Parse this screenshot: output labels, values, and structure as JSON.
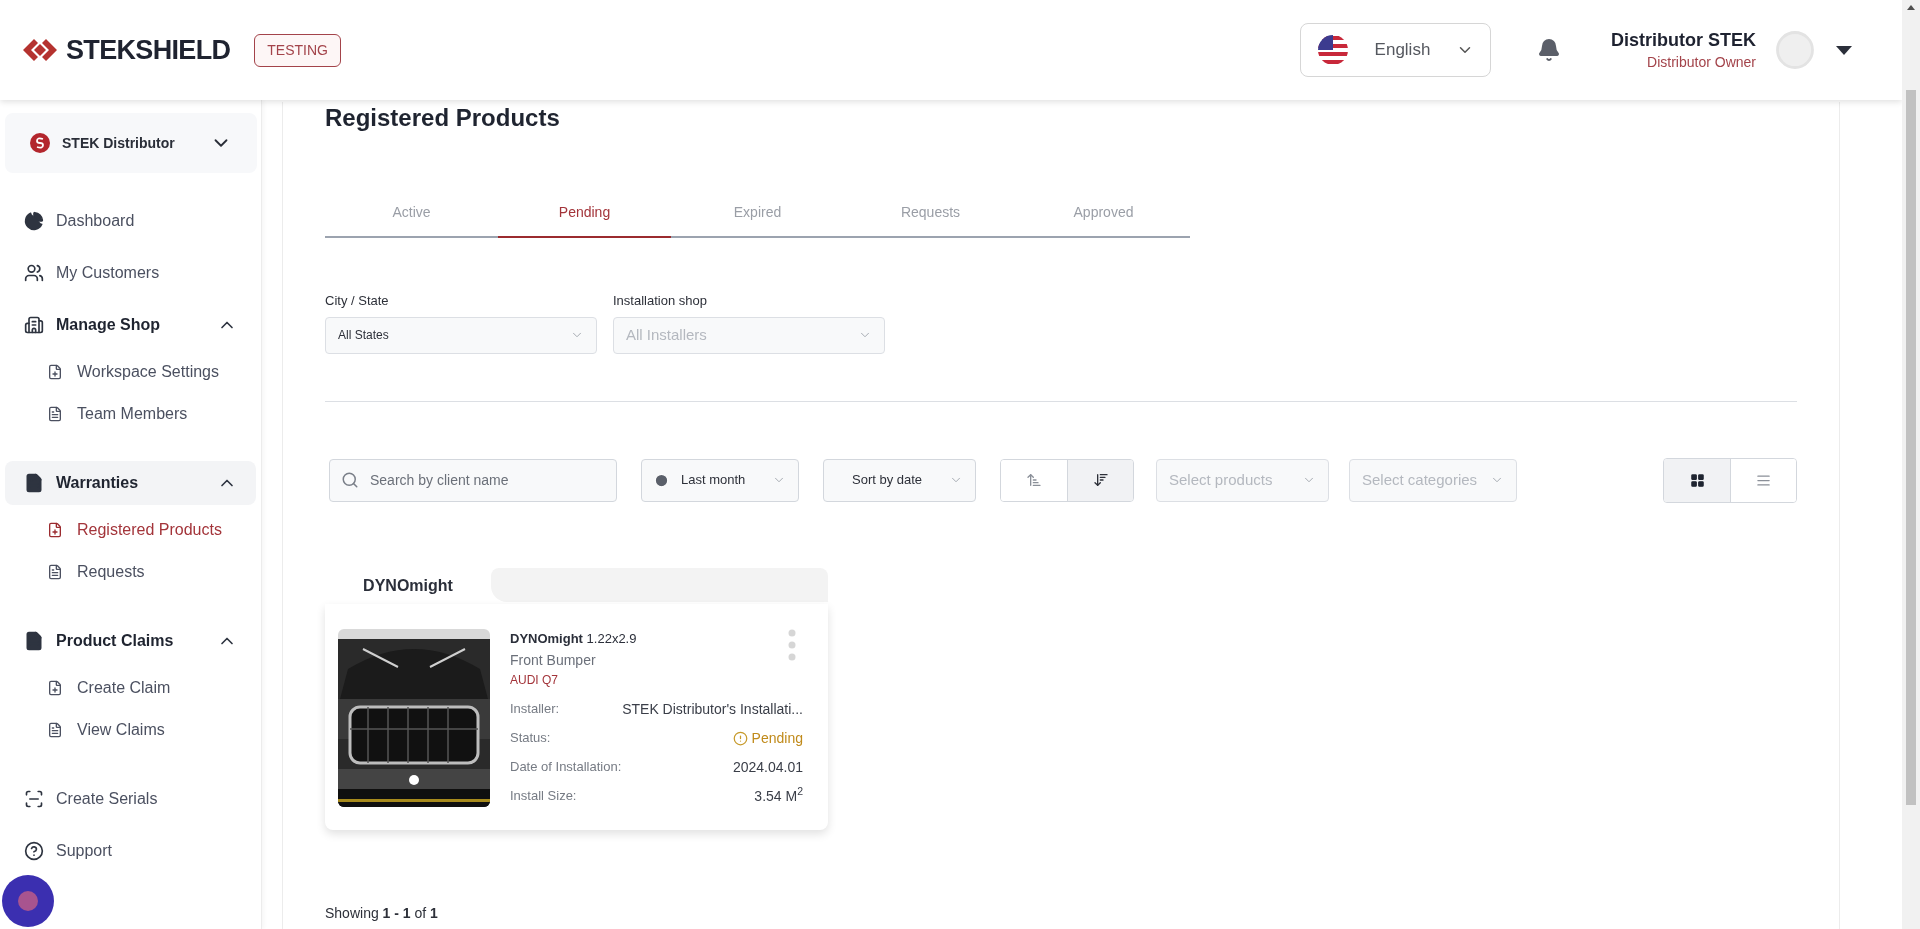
{
  "header": {
    "logo": "STEKSHIELD",
    "env_badge": "TESTING",
    "language": "English",
    "user": {
      "name": "Distributor STEK",
      "role": "Distributor Owner"
    }
  },
  "sidebar": {
    "workspace": "STEK Distributor",
    "items": [
      {
        "label": "Dashboard",
        "kind": "link",
        "selected": false
      },
      {
        "label": "My Customers",
        "kind": "link",
        "selected": false
      },
      {
        "label": "Manage Shop",
        "kind": "group",
        "expanded": true,
        "selected": false,
        "children": [
          {
            "label": "Workspace Settings",
            "selected": false
          },
          {
            "label": "Team Members",
            "selected": false
          }
        ]
      },
      {
        "label": "Warranties",
        "kind": "group",
        "expanded": true,
        "selected": true,
        "children": [
          {
            "label": "Registered Products",
            "selected": true
          },
          {
            "label": "Requests",
            "selected": false
          }
        ]
      },
      {
        "label": "Product Claims",
        "kind": "group",
        "expanded": true,
        "selected": false,
        "children": [
          {
            "label": "Create Claim",
            "selected": false
          },
          {
            "label": "View Claims",
            "selected": false
          }
        ]
      },
      {
        "label": "Create Serials",
        "kind": "link",
        "selected": false
      },
      {
        "label": "Support",
        "kind": "link",
        "selected": false
      }
    ]
  },
  "page": {
    "title": "Registered Products",
    "tabs": [
      {
        "label": "Active",
        "selected": false
      },
      {
        "label": "Pending",
        "selected": true
      },
      {
        "label": "Expired",
        "selected": false
      },
      {
        "label": "Requests",
        "selected": false
      },
      {
        "label": "Approved",
        "selected": false
      }
    ],
    "filters": [
      {
        "label": "City / State",
        "value": "All States"
      },
      {
        "label": "Installation shop",
        "placeholder": "All Installers"
      }
    ],
    "toolbar": {
      "search": {
        "placeholder": "Search by client name"
      },
      "period": "Last month",
      "sort": "Sort by date",
      "sort_order_buttons": [
        {
          "kind": "ascending",
          "selected": false
        },
        {
          "kind": "descending",
          "selected": true
        }
      ],
      "product_select": {
        "placeholder": "Select products"
      },
      "category_select": {
        "placeholder": "Select categories"
      },
      "view_buttons": [
        {
          "kind": "grid",
          "selected": true
        },
        {
          "kind": "list",
          "selected": false
        }
      ]
    },
    "product_groups": [
      {
        "brand": "DYNOmight",
        "items": [
          {
            "image": {
              "kind": "picture"
            },
            "product": "DYNOmight",
            "size": "1.22x2.9",
            "part": "Front Bumper",
            "vehicle": "AUDI Q7",
            "fields": [
              {
                "kind": "text",
                "label": "Installer:",
                "value": "STEK Distributor's Installati..."
              },
              {
                "kind": "status",
                "label": "Status:",
                "value": "Pending"
              },
              {
                "kind": "text",
                "label": "Date of Installation:",
                "value": "2024.04.01"
              },
              {
                "kind": "text",
                "label": "Install Size:",
                "value": "3.54 M$^{2}$"
              }
            ]
          }
        ]
      }
    ],
    "pagination": "Showing **1 - 1** of **1**"
  }
}
